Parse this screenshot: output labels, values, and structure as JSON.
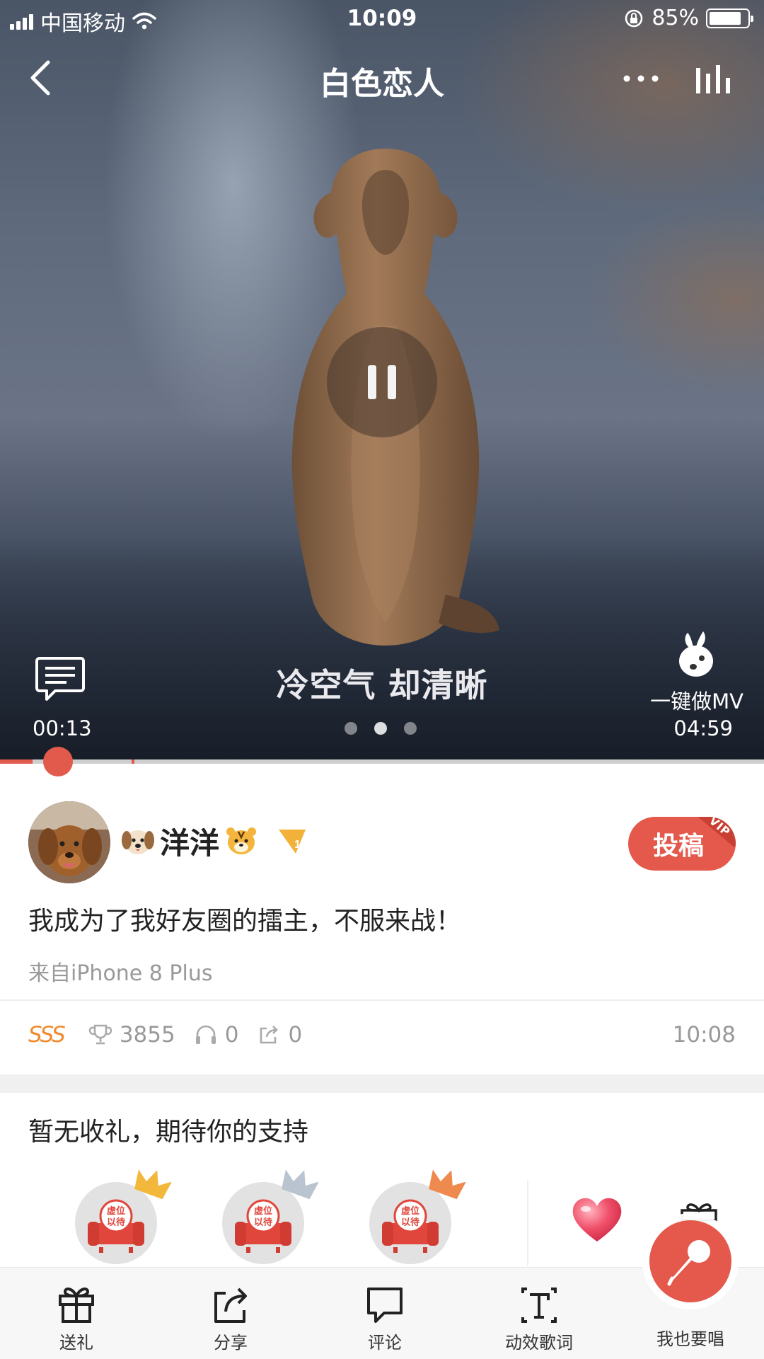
{
  "status_bar": {
    "carrier": "中国移动",
    "time": "10:09",
    "battery_percent": "85%",
    "battery_level": 0.85
  },
  "player": {
    "title": "白色恋人",
    "lyric": "冷空气 却清晰",
    "current_time": "00:13",
    "total_time": "04:59",
    "progress": 0.043,
    "mv_label": "一键做MV",
    "page_count": 3,
    "active_page": 1
  },
  "post": {
    "user_name": "洋洋",
    "emoji_left": "dog-emoji",
    "emoji_right": "tiger-emoji",
    "rank_badge": "1",
    "submit_label": "投稿",
    "vip_tag": "VIP",
    "text": "我成为了我好友圈的擂主，不服来战！",
    "source": "来自iPhone 8 Plus",
    "grade": "SSS",
    "score": "3855",
    "listens": "0",
    "shares": "0",
    "time": "10:08"
  },
  "gifts": {
    "title": "暂无收礼，期待你的支持",
    "seat_label": "虚位以待",
    "seats": [
      {
        "rank": "gold",
        "color": "#f3b73c"
      },
      {
        "rank": "silver",
        "color": "#b9c4d0"
      },
      {
        "rank": "bronze",
        "color": "#ef8a4f"
      }
    ]
  },
  "bottom_bar": {
    "tabs": [
      "送礼",
      "分享",
      "评论",
      "动效歌词"
    ],
    "sing_label": "我也要唱"
  },
  "colors": {
    "accent": "#e4594b",
    "grade": "#f08a2c",
    "muted_text": "#999999"
  }
}
